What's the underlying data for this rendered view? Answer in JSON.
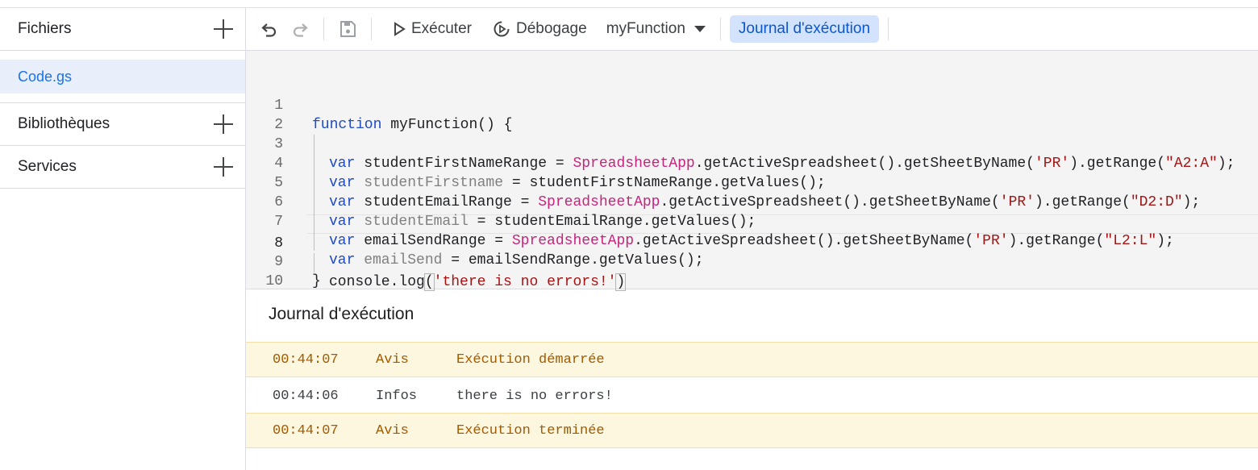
{
  "sidebar": {
    "files_title": "Fichiers",
    "files": [
      {
        "name": "Code.gs"
      }
    ],
    "libraries_title": "Bibliothèques",
    "services_title": "Services"
  },
  "toolbar": {
    "run_label": "Exécuter",
    "debug_label": "Débogage",
    "function_select": "myFunction",
    "log_toggle_label": "Journal d'exécution"
  },
  "editor": {
    "line_numbers": [
      "1",
      "2",
      "3",
      "4",
      "5",
      "6",
      "7",
      "8",
      "9",
      "10"
    ],
    "current_line": "8",
    "code": {
      "l1": {
        "kw": "function",
        "rest": " myFunction() {"
      },
      "l2": {
        "kw": "var",
        "name": " studentFirstNameRange = ",
        "cls": "SpreadsheetApp",
        "mid": ".getActiveSpreadsheet().getSheetByName(",
        "s1": "'PR'",
        "mid2": ").getRange(",
        "s2": "\"A2:A\"",
        "end": ");"
      },
      "l3": {
        "kw": "var",
        "name": " studentFirstname",
        "rest": " = studentFirstNameRange.getValues();"
      },
      "l4": {
        "kw": "var",
        "name": " studentEmailRange = ",
        "cls": "SpreadsheetApp",
        "mid": ".getActiveSpreadsheet().getSheetByName(",
        "s1": "'PR'",
        "mid2": ").getRange(",
        "s2": "\"D2:D\"",
        "end": ");"
      },
      "l5": {
        "kw": "var",
        "name": " studentEmail",
        "rest": " = studentEmailRange.getValues();"
      },
      "l6": {
        "kw": "var",
        "name": " emailSendRange = ",
        "cls": "SpreadsheetApp",
        "mid": ".getActiveSpreadsheet().getSheetByName(",
        "s1": "'PR'",
        "mid2": ").getRange(",
        "s2": "\"L2:L\"",
        "end": ");"
      },
      "l7": {
        "kw": "var",
        "name": " emailSend",
        "rest": " = emailSendRange.getValues();"
      },
      "l8": {
        "pre": "console.log",
        "open": "(",
        "str": "'there is no errors!'",
        "close": ")"
      },
      "l9": {
        "text": "}"
      }
    }
  },
  "log": {
    "title": "Journal d'exécution",
    "rows": [
      {
        "time": "00:44:07",
        "level": "Avis",
        "message": "Exécution démarrée"
      },
      {
        "time": "00:44:06",
        "level": "Infos",
        "message": "there is no errors!"
      },
      {
        "time": "00:44:07",
        "level": "Avis",
        "message": "Exécution terminée"
      }
    ]
  },
  "colors": {
    "accent": "#1a73e8",
    "keyword": "#1f4bc4",
    "class": "#c8247c",
    "string": "#a31515",
    "warning_bg": "#fef7e0",
    "warning_text": "#a05a00"
  }
}
